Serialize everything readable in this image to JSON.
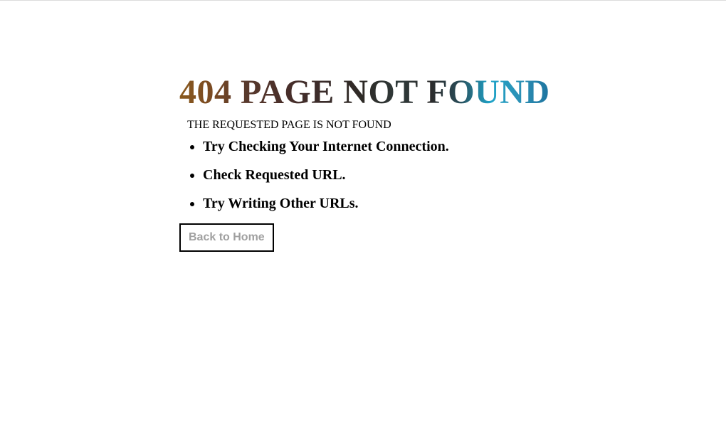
{
  "page": {
    "title": "404 PAGE NOT FOUND",
    "subtitle": "THE REQUESTED PAGE IS NOT FOUND"
  },
  "tips": [
    "Try Checking Your Internet Connection.",
    "Check Requested URL.",
    "Try Writing Other URLs."
  ],
  "actions": {
    "home_button_label": "Back to Home"
  },
  "colors": {
    "title_gradient": [
      "#8a5a1e",
      "#3a2c2a",
      "#2b2b2b",
      "#1fa3c8",
      "#2a86b8"
    ],
    "button_text": "#a0a0a0",
    "button_border": "#000000"
  }
}
